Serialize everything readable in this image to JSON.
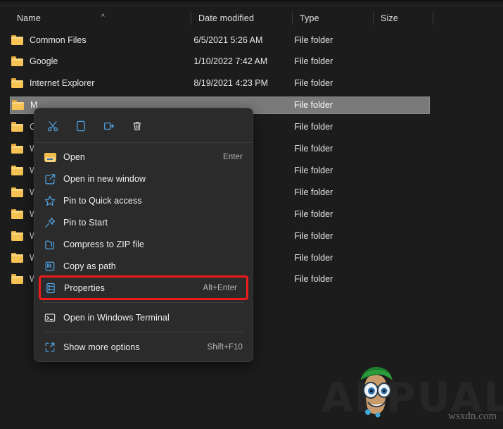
{
  "window": {
    "app": "File Explorer",
    "theme_bg": "#1c1c1c",
    "selection_color": "#7a7a7a",
    "highlight_color": "#ee1b1b"
  },
  "columns": [
    {
      "label": "Name",
      "sort": "ascending"
    },
    {
      "label": "Date modified"
    },
    {
      "label": "Type"
    },
    {
      "label": "Size"
    }
  ],
  "rows": [
    {
      "name": "Common Files",
      "date": "6/5/2021 5:26 AM",
      "type": "File folder",
      "size": "",
      "selected": false
    },
    {
      "name": "Google",
      "date": "1/10/2022 7:42 AM",
      "type": "File folder",
      "size": "",
      "selected": false
    },
    {
      "name": "Internet Explorer",
      "date": "8/19/2021 4:23 PM",
      "type": "File folder",
      "size": "",
      "selected": false
    },
    {
      "name": "M",
      "date": "",
      "type": "File folder",
      "size": "",
      "selected": true
    },
    {
      "name": "On",
      "date": "",
      "type": "File folder",
      "size": "",
      "selected": false
    },
    {
      "name": "W",
      "date": "",
      "type": "File folder",
      "size": "",
      "selected": false
    },
    {
      "name": "W",
      "date": "",
      "type": "File folder",
      "size": "",
      "selected": false
    },
    {
      "name": "W",
      "date": "",
      "type": "File folder",
      "size": "",
      "selected": false
    },
    {
      "name": "W",
      "date": "",
      "type": "File folder",
      "size": "",
      "selected": false
    },
    {
      "name": "W",
      "date": "",
      "type": "File folder",
      "size": "",
      "selected": false
    },
    {
      "name": "W",
      "date": "",
      "type": "File folder",
      "size": "",
      "selected": false
    },
    {
      "name": "W",
      "date": "",
      "type": "File folder",
      "size": "",
      "selected": false
    }
  ],
  "context_menu": {
    "toolbar": [
      {
        "name": "cut",
        "label": "Cut"
      },
      {
        "name": "copy",
        "label": "Copy"
      },
      {
        "name": "rename",
        "label": "Rename"
      },
      {
        "name": "delete",
        "label": "Delete"
      }
    ],
    "items": [
      {
        "label": "Open",
        "shortcut": "Enter",
        "icon": "open-folder-icon",
        "highlighted": false
      },
      {
        "label": "Open in new window",
        "shortcut": "",
        "icon": "new-window-icon",
        "highlighted": false
      },
      {
        "label": "Pin to Quick access",
        "shortcut": "",
        "icon": "star-icon",
        "highlighted": false
      },
      {
        "label": "Pin to Start",
        "shortcut": "",
        "icon": "pin-icon",
        "highlighted": false
      },
      {
        "label": "Compress to ZIP file",
        "shortcut": "",
        "icon": "zip-icon",
        "highlighted": false
      },
      {
        "label": "Copy as path",
        "shortcut": "",
        "icon": "copy-path-icon",
        "highlighted": false
      },
      {
        "label": "Properties",
        "shortcut": "Alt+Enter",
        "icon": "properties-icon",
        "highlighted": true
      },
      {
        "label": "Open in Windows Terminal",
        "shortcut": "",
        "icon": "terminal-icon",
        "highlighted": false,
        "separator_before": true
      },
      {
        "label": "Show more options",
        "shortcut": "Shift+F10",
        "icon": "show-more-icon",
        "highlighted": false,
        "separator_before": true
      }
    ]
  },
  "watermark": {
    "brand": "APPUALS",
    "site": "wsxdn.com"
  }
}
